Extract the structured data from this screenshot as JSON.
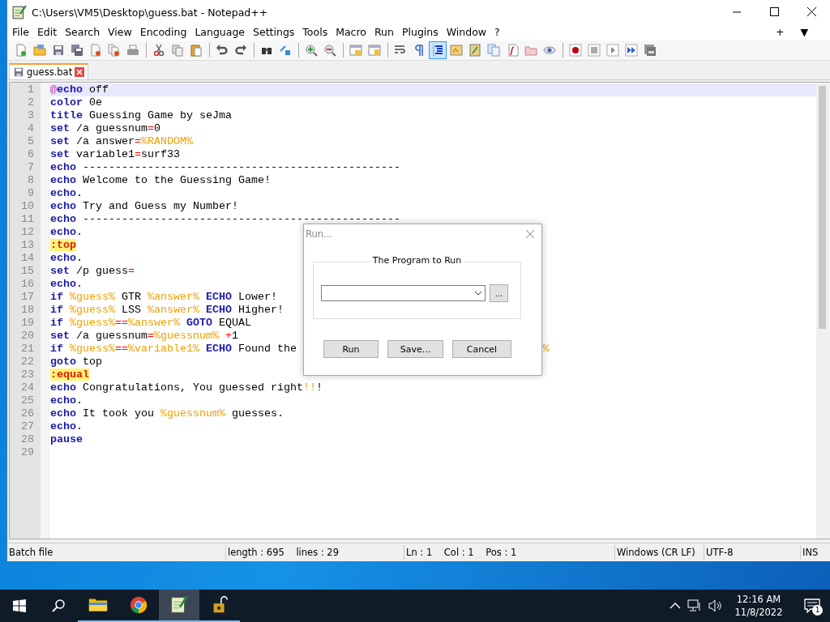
{
  "window": {
    "title": "C:\\Users\\VM5\\Desktop\\guess.bat - Notepad++"
  },
  "menu": {
    "items": [
      "File",
      "Edit",
      "Search",
      "View",
      "Encoding",
      "Language",
      "Settings",
      "Tools",
      "Macro",
      "Run",
      "Plugins",
      "Window",
      "?"
    ],
    "extras": [
      "+",
      "▼"
    ]
  },
  "toolbar": {
    "buttons": [
      {
        "kind": "new",
        "selected": false
      },
      {
        "kind": "open",
        "selected": false
      },
      {
        "kind": "save",
        "selected": false
      },
      {
        "kind": "saveall",
        "selected": false
      },
      {
        "kind": "close",
        "selected": false
      },
      {
        "kind": "closeall",
        "selected": false
      },
      {
        "kind": "print",
        "selected": false
      },
      {
        "kind": "sep"
      },
      {
        "kind": "cut",
        "selected": false
      },
      {
        "kind": "copy",
        "selected": false
      },
      {
        "kind": "paste",
        "selected": false
      },
      {
        "kind": "sep"
      },
      {
        "kind": "undo",
        "selected": false
      },
      {
        "kind": "redo",
        "selected": false
      },
      {
        "kind": "sep"
      },
      {
        "kind": "find",
        "selected": false
      },
      {
        "kind": "replace",
        "selected": false
      },
      {
        "kind": "sep"
      },
      {
        "kind": "zoomin",
        "selected": false
      },
      {
        "kind": "zoomout",
        "selected": false
      },
      {
        "kind": "sep"
      },
      {
        "kind": "syncv",
        "selected": false
      },
      {
        "kind": "synch",
        "selected": false
      },
      {
        "kind": "sep"
      },
      {
        "kind": "wrap",
        "selected": false
      },
      {
        "kind": "allchars",
        "selected": false
      },
      {
        "kind": "indent",
        "selected": true
      },
      {
        "kind": "udl",
        "selected": false
      },
      {
        "kind": "docmap",
        "selected": false
      },
      {
        "kind": "doclist",
        "selected": false
      },
      {
        "kind": "funclist",
        "selected": false
      },
      {
        "kind": "folder",
        "selected": false
      },
      {
        "kind": "monitor",
        "selected": false
      },
      {
        "kind": "sep"
      },
      {
        "kind": "record",
        "selected": false
      },
      {
        "kind": "stop",
        "selected": false
      },
      {
        "kind": "play",
        "selected": false
      },
      {
        "kind": "playmulti",
        "selected": false
      },
      {
        "kind": "savemacro",
        "selected": false
      }
    ]
  },
  "tabs": [
    {
      "label": "guess.bat",
      "selected": true
    }
  ],
  "editor": {
    "lines": [
      {
        "number": "1",
        "current": true,
        "tokens": [
          {
            "kind": "at",
            "text": "@"
          },
          {
            "kind": "kw",
            "text": "echo"
          },
          {
            "kind": "txt",
            "text": " off"
          }
        ]
      },
      {
        "number": "2",
        "current": false,
        "tokens": [
          {
            "kind": "kw",
            "text": "color"
          },
          {
            "kind": "txt",
            "text": " 0e"
          }
        ]
      },
      {
        "number": "3",
        "current": false,
        "tokens": [
          {
            "kind": "kw",
            "text": "title"
          },
          {
            "kind": "txt",
            "text": " Guessing Game by seJma"
          }
        ]
      },
      {
        "number": "4",
        "current": false,
        "tokens": [
          {
            "kind": "kw",
            "text": "set"
          },
          {
            "kind": "txt",
            "text": " /a guessnum"
          },
          {
            "kind": "op",
            "text": "="
          },
          {
            "kind": "txt",
            "text": "0"
          }
        ]
      },
      {
        "number": "5",
        "current": false,
        "tokens": [
          {
            "kind": "kw",
            "text": "set"
          },
          {
            "kind": "txt",
            "text": " /a answer"
          },
          {
            "kind": "op",
            "text": "="
          },
          {
            "kind": "var",
            "text": "%RANDOM%"
          }
        ]
      },
      {
        "number": "6",
        "current": false,
        "tokens": [
          {
            "kind": "kw",
            "text": "set"
          },
          {
            "kind": "txt",
            "text": " variable1"
          },
          {
            "kind": "op",
            "text": "="
          },
          {
            "kind": "txt",
            "text": "surf33"
          }
        ]
      },
      {
        "number": "7",
        "current": false,
        "tokens": [
          {
            "kind": "kw",
            "text": "echo"
          },
          {
            "kind": "txt",
            "text": " -------------------------------------------------"
          }
        ]
      },
      {
        "number": "8",
        "current": false,
        "tokens": [
          {
            "kind": "kw",
            "text": "echo"
          },
          {
            "kind": "txt",
            "text": " Welcome to the Guessing Game!"
          }
        ]
      },
      {
        "number": "9",
        "current": false,
        "tokens": [
          {
            "kind": "kw",
            "text": "echo"
          },
          {
            "kind": "txt",
            "text": "."
          }
        ]
      },
      {
        "number": "10",
        "current": false,
        "tokens": [
          {
            "kind": "kw",
            "text": "echo"
          },
          {
            "kind": "txt",
            "text": " Try and Guess my Number!"
          }
        ]
      },
      {
        "number": "11",
        "current": false,
        "tokens": [
          {
            "kind": "kw",
            "text": "echo"
          },
          {
            "kind": "txt",
            "text": " -------------------------------------------------"
          }
        ]
      },
      {
        "number": "12",
        "current": false,
        "tokens": [
          {
            "kind": "kw",
            "text": "echo"
          },
          {
            "kind": "txt",
            "text": "."
          }
        ]
      },
      {
        "number": "13",
        "current": false,
        "tokens": [
          {
            "kind": "label",
            "text": ":top"
          }
        ]
      },
      {
        "number": "14",
        "current": false,
        "tokens": [
          {
            "kind": "kw",
            "text": "echo"
          },
          {
            "kind": "txt",
            "text": "."
          }
        ]
      },
      {
        "number": "15",
        "current": false,
        "tokens": [
          {
            "kind": "kw",
            "text": "set"
          },
          {
            "kind": "txt",
            "text": " /p guess"
          },
          {
            "kind": "op",
            "text": "="
          }
        ]
      },
      {
        "number": "16",
        "current": false,
        "tokens": [
          {
            "kind": "kw",
            "text": "echo"
          },
          {
            "kind": "txt",
            "text": "."
          }
        ]
      },
      {
        "number": "17",
        "current": false,
        "tokens": [
          {
            "kind": "kw",
            "text": "if "
          },
          {
            "kind": "var",
            "text": "%guess%"
          },
          {
            "kind": "txt",
            "text": " GTR "
          },
          {
            "kind": "var",
            "text": "%answer% "
          },
          {
            "kind": "kw",
            "text": "ECHO"
          },
          {
            "kind": "txt",
            "text": " Lower!"
          }
        ]
      },
      {
        "number": "18",
        "current": false,
        "tokens": [
          {
            "kind": "kw",
            "text": "if "
          },
          {
            "kind": "var",
            "text": "%guess%"
          },
          {
            "kind": "txt",
            "text": " LSS "
          },
          {
            "kind": "var",
            "text": "%answer% "
          },
          {
            "kind": "kw",
            "text": "ECHO"
          },
          {
            "kind": "txt",
            "text": " Higher!"
          }
        ]
      },
      {
        "number": "19",
        "current": false,
        "tokens": [
          {
            "kind": "kw",
            "text": "if "
          },
          {
            "kind": "var",
            "text": "%guess%"
          },
          {
            "kind": "op",
            "text": "=="
          },
          {
            "kind": "var",
            "text": "%answer% "
          },
          {
            "kind": "kw",
            "text": "GOTO"
          },
          {
            "kind": "txt",
            "text": " EQUAL"
          }
        ]
      },
      {
        "number": "20",
        "current": false,
        "tokens": [
          {
            "kind": "kw",
            "text": "set"
          },
          {
            "kind": "txt",
            "text": " /a guessnum"
          },
          {
            "kind": "op",
            "text": "="
          },
          {
            "kind": "var",
            "text": "%guessnum% "
          },
          {
            "kind": "op",
            "text": "+"
          },
          {
            "kind": "txt",
            "text": "1"
          }
        ]
      },
      {
        "number": "21",
        "current": false,
        "tokens": [
          {
            "kind": "kw",
            "text": "if "
          },
          {
            "kind": "var",
            "text": "%guess%"
          },
          {
            "kind": "op",
            "text": "=="
          },
          {
            "kind": "var",
            "text": "%variable1% "
          },
          {
            "kind": "kw",
            "text": "ECHO"
          },
          {
            "kind": "txt",
            "text": " Found the"
          },
          {
            "kind": "far",
            "text": "%"
          }
        ]
      },
      {
        "number": "22",
        "current": false,
        "tokens": [
          {
            "kind": "kw",
            "text": "goto"
          },
          {
            "kind": "txt",
            "text": " top"
          }
        ]
      },
      {
        "number": "23",
        "current": false,
        "tokens": [
          {
            "kind": "label",
            "text": ":equal"
          }
        ]
      },
      {
        "number": "24",
        "current": false,
        "tokens": [
          {
            "kind": "kw",
            "text": "echo"
          },
          {
            "kind": "txt",
            "text": " Congratulations, You guessed right"
          },
          {
            "kind": "var",
            "text": "!!"
          },
          {
            "kind": "txt",
            "text": "!"
          }
        ]
      },
      {
        "number": "25",
        "current": false,
        "tokens": [
          {
            "kind": "kw",
            "text": "echo"
          },
          {
            "kind": "txt",
            "text": "."
          }
        ]
      },
      {
        "number": "26",
        "current": false,
        "tokens": [
          {
            "kind": "kw",
            "text": "echo"
          },
          {
            "kind": "txt",
            "text": " It took you "
          },
          {
            "kind": "var",
            "text": "%guessnum%"
          },
          {
            "kind": "txt",
            "text": " guesses."
          }
        ]
      },
      {
        "number": "27",
        "current": false,
        "tokens": [
          {
            "kind": "kw",
            "text": "echo"
          },
          {
            "kind": "txt",
            "text": "."
          }
        ]
      },
      {
        "number": "28",
        "current": false,
        "tokens": [
          {
            "kind": "kw",
            "text": "pause"
          }
        ]
      },
      {
        "number": "29",
        "current": false
      }
    ]
  },
  "dialog": {
    "title": "Run...",
    "group_label": "The Program to Run",
    "browse_button": "...",
    "buttons": [
      "Run",
      "Save...",
      "Cancel"
    ]
  },
  "status_bar": [
    "Batch file",
    "length : 695    lines : 29",
    "Ln : 1    Col : 1    Pos : 1",
    "Windows (CR LF)",
    "UTF-8",
    "INS"
  ],
  "taskbar": {
    "apps": [
      {
        "kind": "folder",
        "running": true,
        "selected": false
      },
      {
        "kind": "browser",
        "running": true,
        "selected": false
      },
      {
        "kind": "notepad",
        "running": true,
        "selected": true
      },
      {
        "kind": "lock",
        "running": true,
        "selected": false
      }
    ],
    "time": "12:16 AM",
    "date": "11/8/2022",
    "notification_count": "1"
  }
}
